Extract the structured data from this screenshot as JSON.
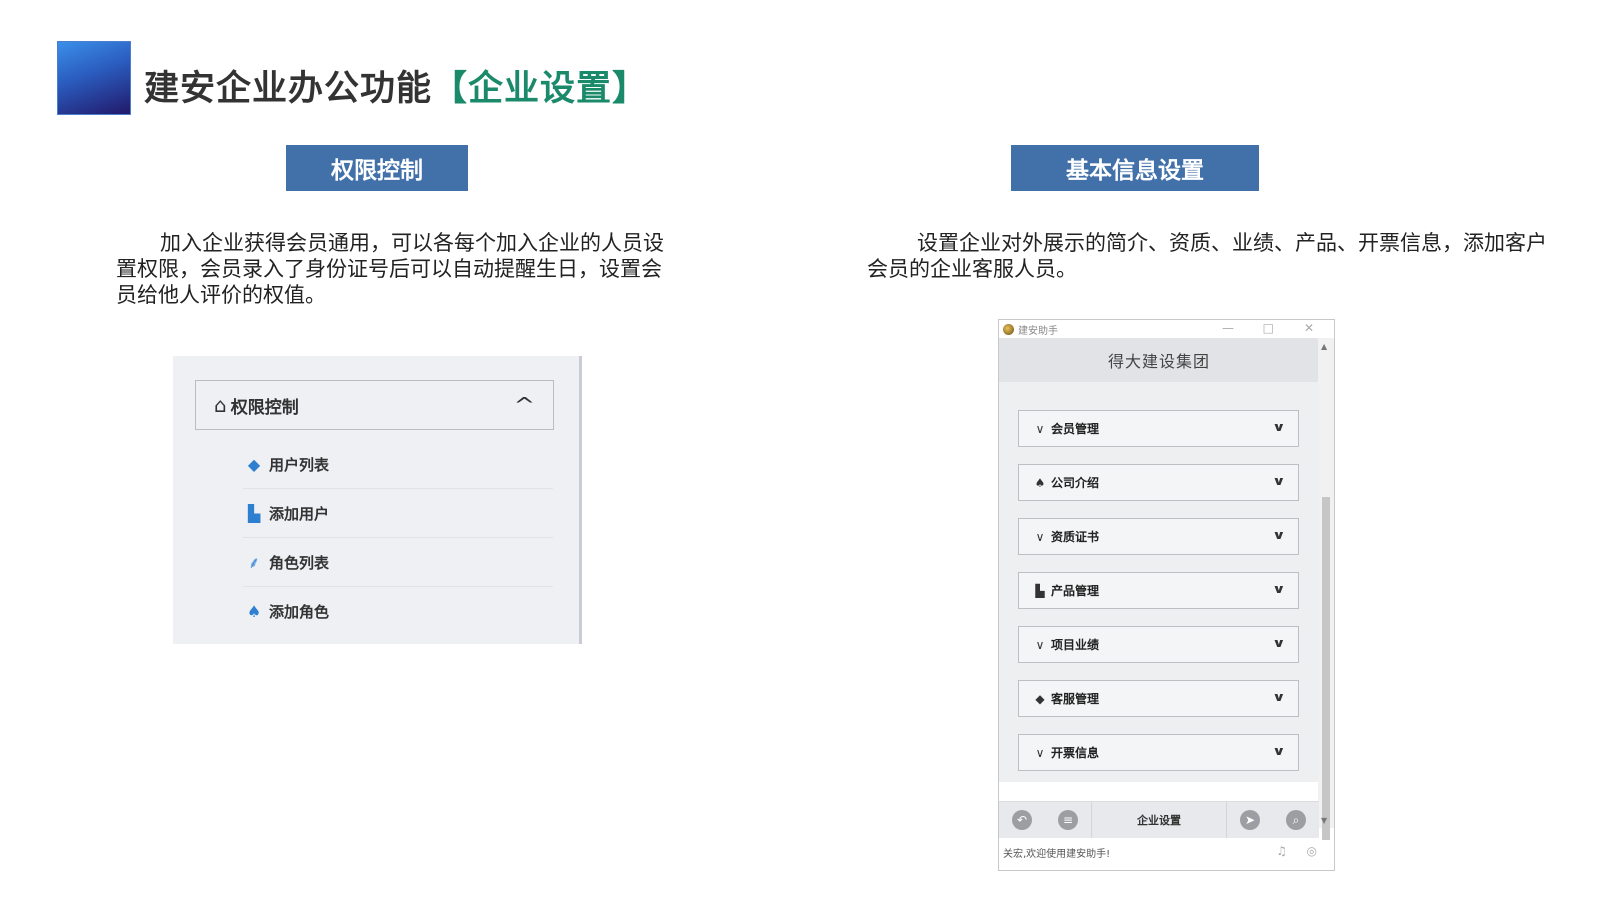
{
  "header": {
    "title_main": "建安企业办公功能",
    "title_highlight": "【企业设置】"
  },
  "left_section": {
    "button_label": "权限控制",
    "description": "加入企业获得会员通用，可以各每个加入企业的人员设置权限，会员录入了身份证号后可以自动提醒生日，设置会员给他人评价的权值。",
    "panel": {
      "header_icon": "home-icon",
      "header_label": "权限控制",
      "items": [
        {
          "icon": "eraser-icon",
          "label": "用户列表"
        },
        {
          "icon": "user-add-icon",
          "label": "添加用户"
        },
        {
          "icon": "tree-icon",
          "label": "角色列表"
        },
        {
          "icon": "pin-icon",
          "label": "添加角色"
        }
      ]
    }
  },
  "right_section": {
    "button_label": "基本信息设置",
    "description": "设置企业对外展示的简介、资质、业绩、产品、开票信息，添加客户会员的企业客服人员。",
    "window": {
      "app_title": "建安助手",
      "company": "得大建设集团",
      "accordions": [
        {
          "icon": "chevron-down-icon",
          "label": "会员管理"
        },
        {
          "icon": "pin-icon",
          "label": "公司介绍"
        },
        {
          "icon": "chevron-down-icon",
          "label": "资质证书"
        },
        {
          "icon": "user-add-icon",
          "label": "产品管理"
        },
        {
          "icon": "chevron-down-icon",
          "label": "项目业绩"
        },
        {
          "icon": "eraser-icon",
          "label": "客服管理"
        },
        {
          "icon": "chevron-down-icon",
          "label": "开票信息"
        }
      ],
      "footer_center": "企业设置",
      "status_text": "关宏,欢迎使用建安助手!"
    }
  },
  "colors": {
    "accent": "#4271aa",
    "highlight": "#1a8a6a"
  }
}
